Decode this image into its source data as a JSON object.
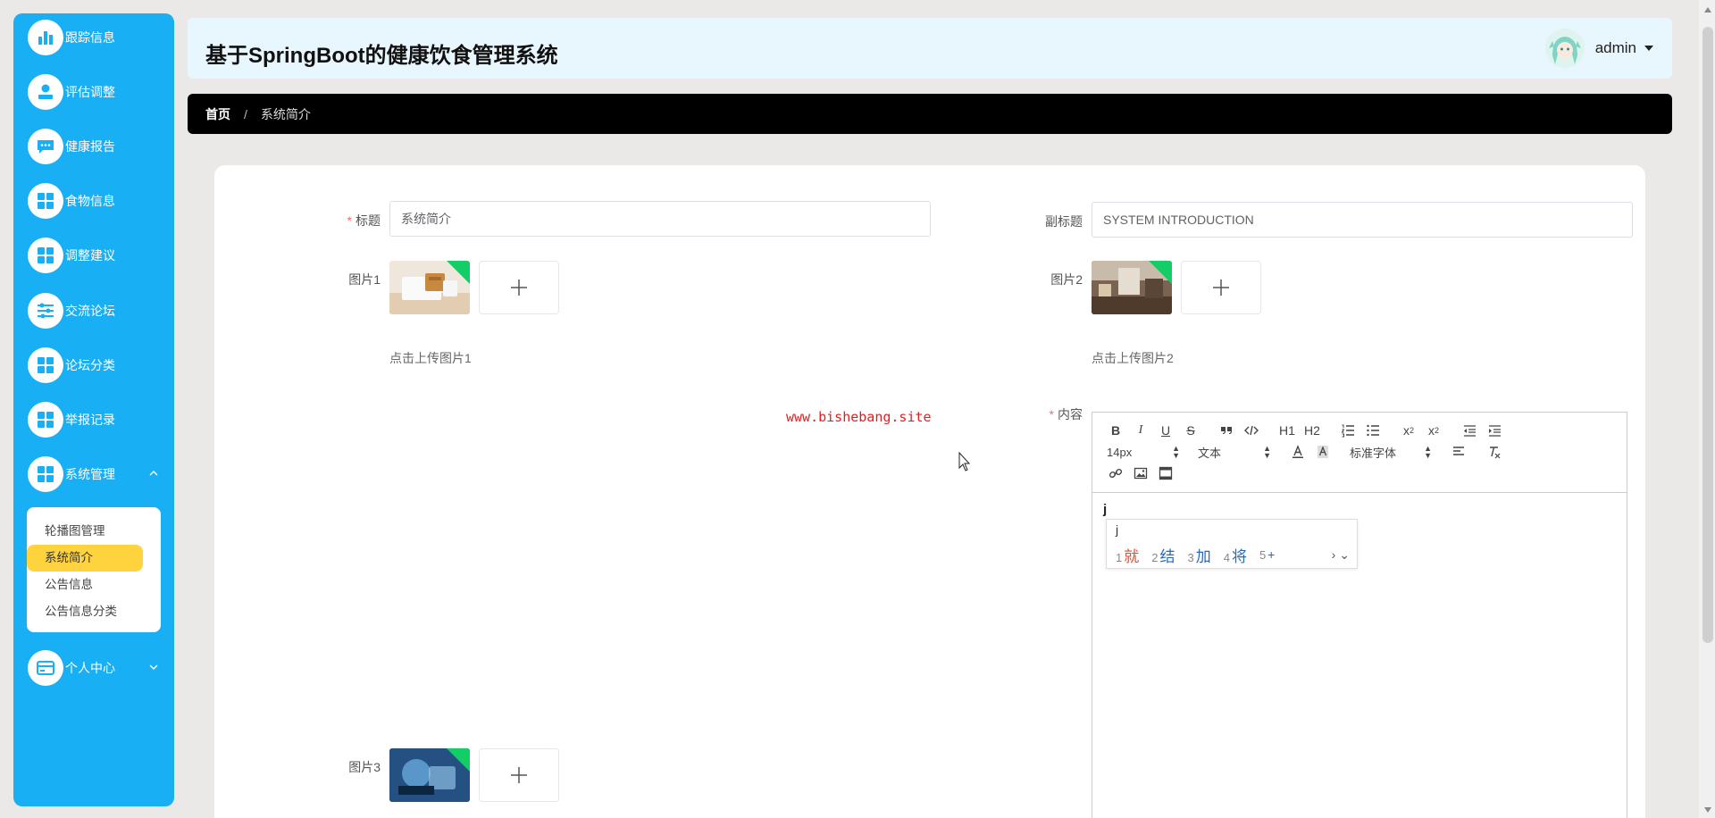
{
  "app": {
    "title": "基于SpringBoot的健康饮食管理系统"
  },
  "user": {
    "name": "admin"
  },
  "sidebar": {
    "items": [
      {
        "label": "跟踪信息",
        "icon": "bar-chart-icon"
      },
      {
        "label": "评估调整",
        "icon": "user-icon"
      },
      {
        "label": "健康报告",
        "icon": "chat-icon"
      },
      {
        "label": "食物信息",
        "icon": "grid-icon"
      },
      {
        "label": "调整建议",
        "icon": "grid-icon"
      },
      {
        "label": "交流论坛",
        "icon": "sliders-icon"
      },
      {
        "label": "论坛分类",
        "icon": "grid-icon"
      },
      {
        "label": "举报记录",
        "icon": "grid-icon"
      },
      {
        "label": "系统管理",
        "icon": "grid-icon"
      },
      {
        "label": "个人中心",
        "icon": "card-icon"
      }
    ],
    "submenu": [
      {
        "label": "轮播图管理"
      },
      {
        "label": "系统简介"
      },
      {
        "label": "公告信息"
      },
      {
        "label": "公告信息分类"
      }
    ]
  },
  "breadcrumb": {
    "home": "首页",
    "separator": "/",
    "current": "系统简介"
  },
  "form": {
    "title_label": "标题",
    "title_value": "系统简介",
    "subtitle_label": "副标题",
    "subtitle_value": "SYSTEM INTRODUCTION",
    "pic1_label": "图片1",
    "pic1_hint": "点击上传图片1",
    "pic2_label": "图片2",
    "pic2_hint": "点击上传图片2",
    "pic3_label": "图片3",
    "content_label": "内容",
    "required_mark": "*"
  },
  "watermark": "www.bishebang.site",
  "editor": {
    "font_size": "14px",
    "paragraph": "文本",
    "font_family": "标准字体",
    "h1": "H1",
    "h2": "H2",
    "content_text": "j"
  },
  "ime": {
    "input": "j",
    "candidates": [
      {
        "num": "1",
        "text": "就"
      },
      {
        "num": "2",
        "text": "结"
      },
      {
        "num": "3",
        "text": "加"
      },
      {
        "num": "4",
        "text": "将"
      },
      {
        "num": "5",
        "text": "+"
      }
    ]
  },
  "colors": {
    "sidebar": "#19aff5",
    "active_sub": "#ffd33d",
    "header": "#e8f6fd",
    "breadcrumb": "#000000",
    "required": "#f56c6c"
  }
}
